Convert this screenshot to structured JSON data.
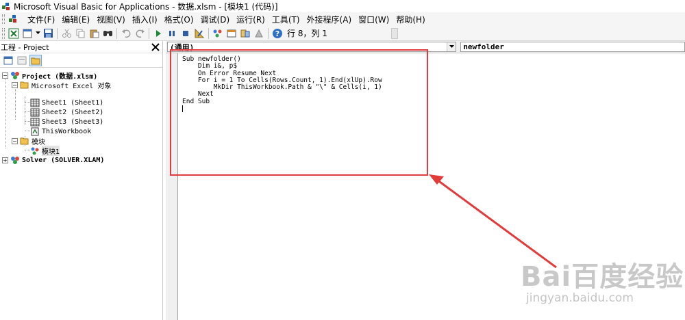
{
  "window": {
    "title": "Microsoft Visual Basic for Applications - 数据.xlsm - [模块1 (代码)]"
  },
  "menu": {
    "items": [
      "文件(F)",
      "编辑(E)",
      "视图(V)",
      "插入(I)",
      "格式(O)",
      "调试(D)",
      "运行(R)",
      "工具(T)",
      "外接程序(A)",
      "窗口(W)",
      "帮助(H)"
    ]
  },
  "toolbar": {
    "position_text": "行 8，列 1",
    "icons": [
      "excel-icon",
      "insert-module-icon",
      "save-icon",
      "cut-icon",
      "copy-icon",
      "paste-icon",
      "find-icon",
      "undo-icon",
      "redo-icon",
      "run-icon",
      "break-icon",
      "reset-icon",
      "design-mode-icon",
      "project-explorer-icon",
      "properties-icon",
      "object-browser-icon",
      "toolbox-icon",
      "help-icon"
    ]
  },
  "project": {
    "title": "工程 - Project",
    "tree": {
      "project1": "Project (数据.xlsm)",
      "excel_objects": "Microsoft Excel 对象",
      "sheet1": "Sheet1 (Sheet1)",
      "sheet2": "Sheet2 (Sheet2)",
      "sheet3": "Sheet3 (Sheet3)",
      "thisworkbook": "ThisWorkbook",
      "modules": "模块",
      "module1": "模块1",
      "project2": "Solver (SOLVER.XLAM)"
    }
  },
  "code_window": {
    "object_combo": "(通用)",
    "procedure_combo": "newfolder",
    "lines": [
      "Sub newfolder()",
      "    Dim i&, p$",
      "    On Error Resume Next",
      "    For i = 1 To Cells(Rows.Count, 1).End(xlUp).Row",
      "        MkDir ThisWorkbook.Path & \"\\\" & Cells(i, 1)",
      "    Next",
      "End Sub",
      ""
    ]
  },
  "watermark": {
    "logo": "Bai百度经验",
    "url": "jingyan.baidu.com"
  },
  "colors": {
    "annotation": "#e13b3b",
    "keyword": "#00007f",
    "selection": "#cfe3f7"
  }
}
